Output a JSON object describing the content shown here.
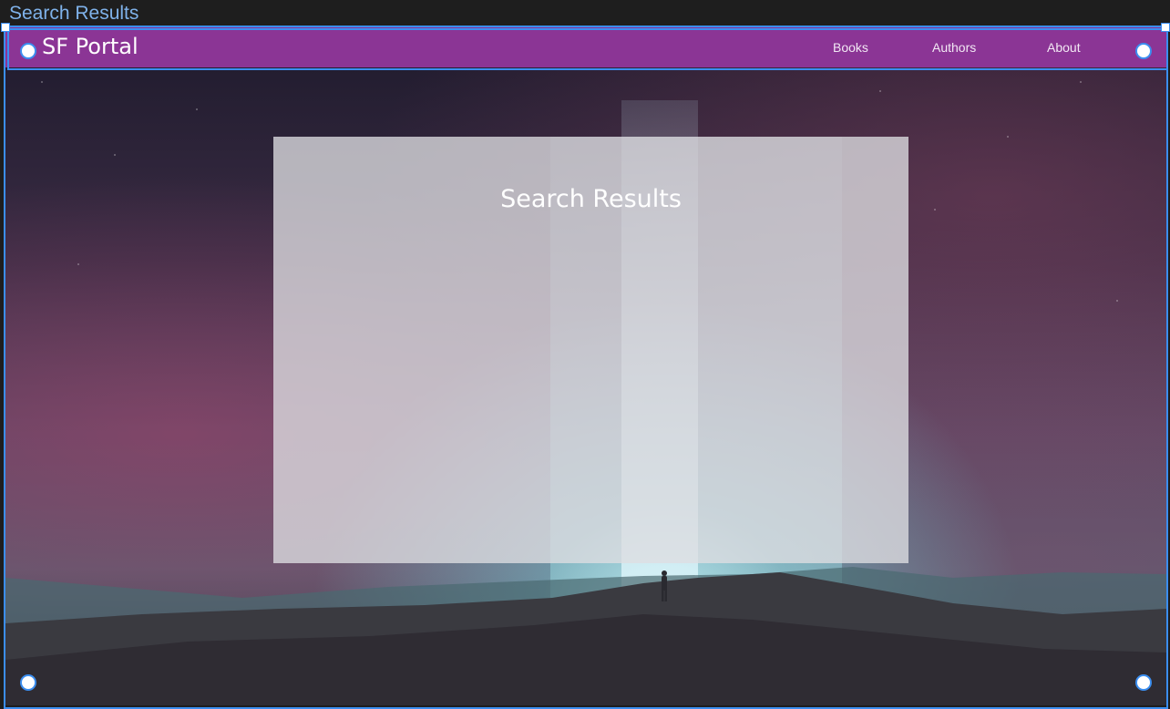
{
  "frame": {
    "title": "Search Results"
  },
  "navbar": {
    "brand": "SF Portal",
    "links": [
      "Books",
      "Authors",
      "About"
    ],
    "background": "#8b3595"
  },
  "main": {
    "panel_title": "Search Results"
  },
  "colors": {
    "selection": "#3b8ef0",
    "frame_label": "#7fb2ea"
  }
}
